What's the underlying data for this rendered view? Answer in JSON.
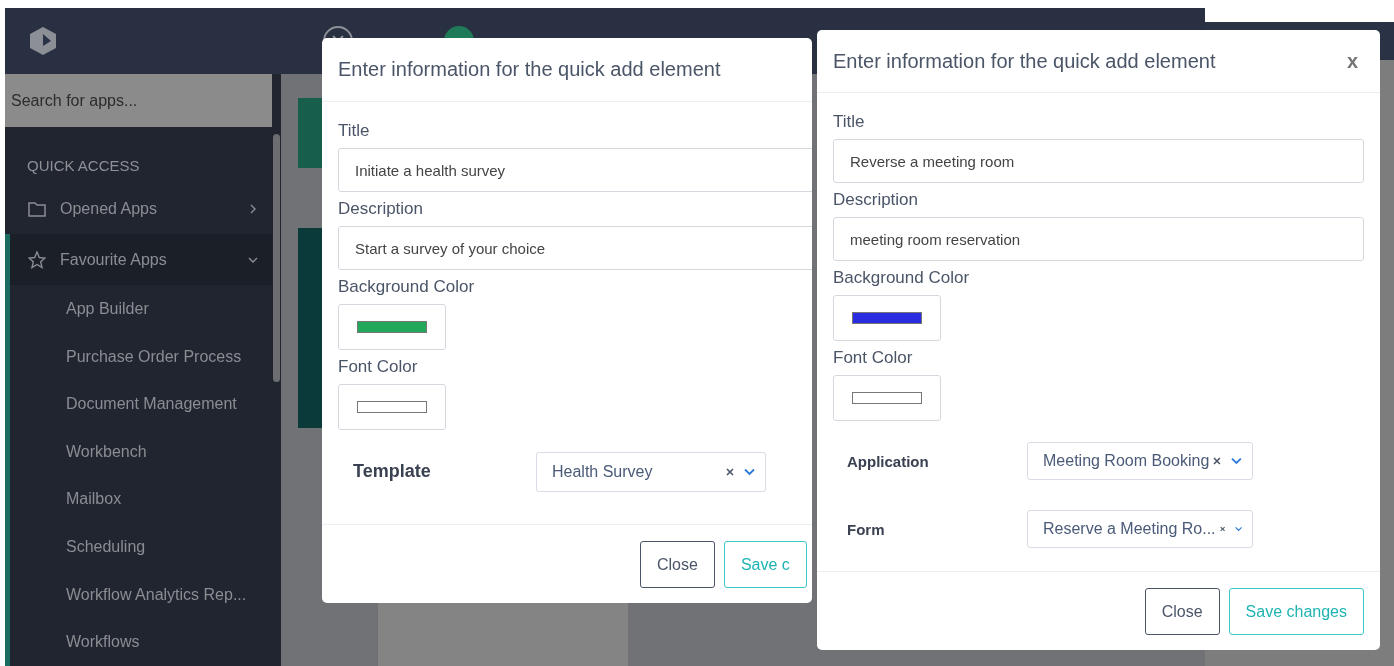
{
  "app": {
    "search": {
      "placeholder": "Search for apps..."
    },
    "sidebar": {
      "section": "QUICK ACCESS",
      "items": [
        {
          "label": "Opened Apps",
          "expanded": false,
          "selected": false
        },
        {
          "label": "Favourite Apps",
          "expanded": true,
          "selected": true,
          "children": [
            {
              "label": "App Builder"
            },
            {
              "label": "Purchase Order Process"
            },
            {
              "label": "Document Management"
            },
            {
              "label": "Workbench"
            },
            {
              "label": "Mailbox"
            },
            {
              "label": "Scheduling"
            },
            {
              "label": "Workflow Analytics Rep..."
            },
            {
              "label": "Workflows"
            }
          ]
        }
      ]
    }
  },
  "dialogs": [
    {
      "title": "Enter information for the quick add element",
      "fields": [
        {
          "kind": "text",
          "label": "Title",
          "value": "Initiate a health survey"
        },
        {
          "kind": "text",
          "label": "Description",
          "value": "Start a survey of your choice"
        },
        {
          "kind": "color",
          "label": "Background Color",
          "color": "#22a85a"
        },
        {
          "kind": "color",
          "label": "Font Color",
          "color": "#ffffff"
        },
        {
          "kind": "select",
          "label": "Template",
          "value": "Health Survey"
        }
      ],
      "buttons": [
        {
          "label": "Close",
          "kind": "secondary"
        },
        {
          "label": "Save c",
          "kind": "primary"
        }
      ]
    },
    {
      "title": "Enter information for the quick add element",
      "close_label": "x",
      "fields": [
        {
          "kind": "text",
          "label": "Title",
          "value": "Reverse a meeting room"
        },
        {
          "kind": "text",
          "label": "Description",
          "value": "meeting room reservation"
        },
        {
          "kind": "color",
          "label": "Background Color",
          "color": "#2b2be0"
        },
        {
          "kind": "color",
          "label": "Font Color",
          "color": "#ffffff"
        },
        {
          "kind": "select",
          "label": "Application",
          "value": "Meeting Room Booking"
        },
        {
          "kind": "select",
          "label": "Form",
          "value": "Reserve a Meeting Ro..."
        }
      ],
      "buttons": [
        {
          "label": "Close",
          "kind": "secondary"
        },
        {
          "label": "Save changes",
          "kind": "primary"
        }
      ]
    }
  ]
}
